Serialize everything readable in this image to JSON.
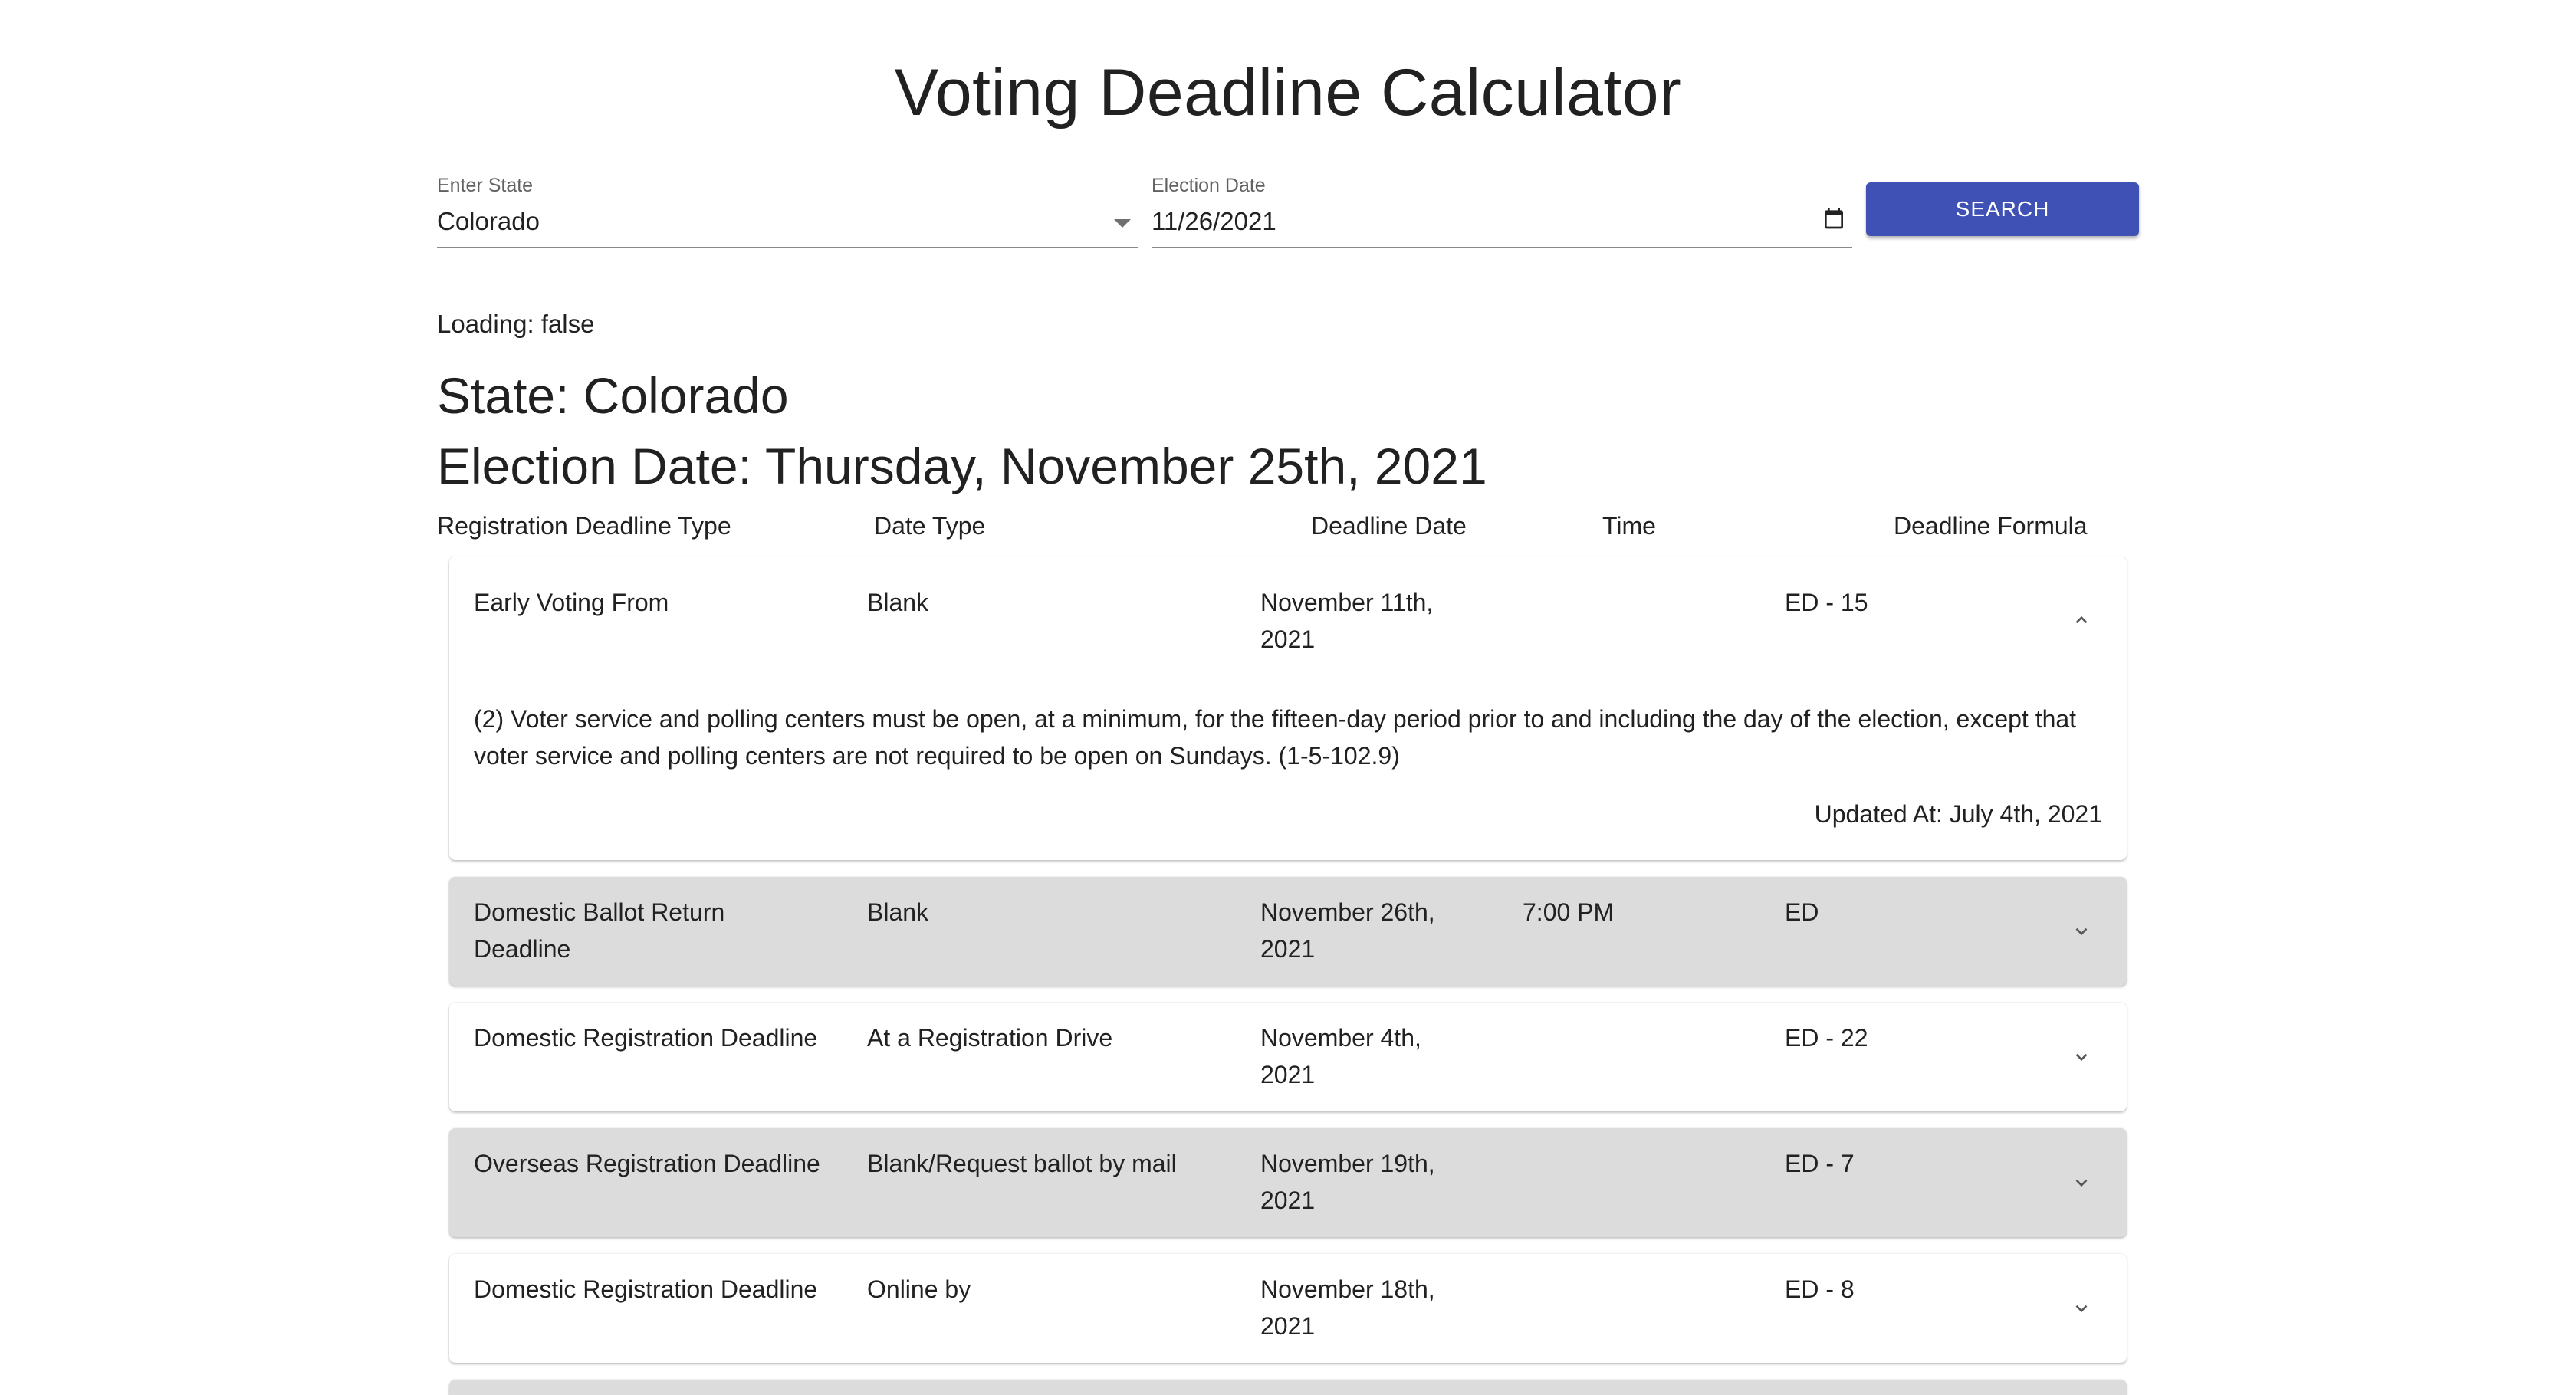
{
  "page": {
    "title": "Voting Deadline Calculator",
    "state_field": {
      "label": "Enter State",
      "value": "Colorado"
    },
    "date_field": {
      "label": "Election Date",
      "value": "11/26/2021"
    },
    "search_label": "SEARCH",
    "loading_text": "Loading: false",
    "state_heading": "State: Colorado",
    "election_heading": "Election Date: Thursday, November 25th, 2021"
  },
  "table": {
    "headers": [
      "Registration Deadline Type",
      "Date Type",
      "Deadline Date",
      "Time",
      "Deadline Formula"
    ],
    "rows": [
      {
        "type_l1": "Early Voting From",
        "type_l2": "",
        "date_type": "Blank",
        "date_l1": "November 11th,",
        "date_l2": "2021",
        "time": "",
        "formula": "ED - 15",
        "expanded": true,
        "detail_l1": "(2) Voter service and polling centers must be open, at a minimum, for the fifteen-day period prior to and including the day of the election, except that",
        "detail_l2": "voter service and polling centers are not required to be open on Sundays. (1-5-102.9)",
        "updated": "Updated At: July 4th, 2021"
      },
      {
        "type_l1": "Domestic Ballot Return",
        "type_l2": "Deadline",
        "date_type": "Blank",
        "date_l1": "November 26th,",
        "date_l2": "2021",
        "time": "7:00 PM",
        "formula": "ED",
        "expanded": false
      },
      {
        "type_l1": "Domestic Registration Deadline",
        "type_l2": "",
        "date_type": "At a Registration Drive",
        "date_l1": "November 4th,",
        "date_l2": "2021",
        "time": "",
        "formula": "ED - 22",
        "expanded": false
      },
      {
        "type_l1": "Overseas Registration Deadline",
        "type_l2": "",
        "date_type": "Blank/Request ballot by mail",
        "date_l1": "November 19th,",
        "date_l2": "2021",
        "time": "",
        "formula": "ED - 7",
        "expanded": false
      },
      {
        "type_l1": "Domestic Registration Deadline",
        "type_l2": "",
        "date_type": "Online by",
        "date_l1": "November 18th,",
        "date_l2": "2021",
        "time": "",
        "formula": "ED - 8",
        "expanded": false
      }
    ]
  },
  "icons": {
    "state_dropdown": "caret-down-icon",
    "date_picker": "calendar-icon",
    "expand": "chevron-icon"
  },
  "colors": {
    "primary": "#3f51b5",
    "row_alt": "#dcdcdc",
    "row": "#ffffff"
  }
}
